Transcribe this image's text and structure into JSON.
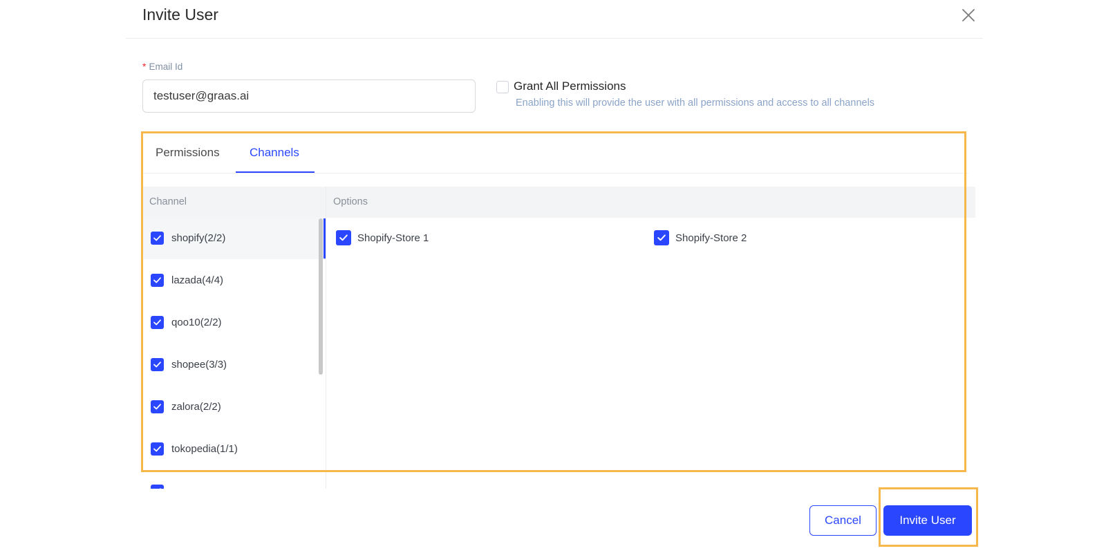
{
  "modal": {
    "title": "Invite User"
  },
  "email": {
    "label": "Email Id",
    "required_mark": "*",
    "value": "testuser@graas.ai"
  },
  "grant_all": {
    "label": "Grant All Permissions",
    "help": "Enabling this will provide the user with all permissions and access to all channels",
    "checked": false
  },
  "tabs": [
    {
      "label": "Permissions",
      "active": false
    },
    {
      "label": "Channels",
      "active": true
    }
  ],
  "table": {
    "headers": {
      "channel": "Channel",
      "options": "Options"
    },
    "channels": [
      {
        "label": "shopify(2/2)",
        "checked": true,
        "active": true
      },
      {
        "label": "lazada(4/4)",
        "checked": true
      },
      {
        "label": "qoo10(2/2)",
        "checked": true
      },
      {
        "label": "shopee(3/3)",
        "checked": true
      },
      {
        "label": "zalora(2/2)",
        "checked": true
      },
      {
        "label": "tokopedia(1/1)",
        "checked": true
      }
    ],
    "options": [
      {
        "label": "Shopify-Store 1",
        "checked": true
      },
      {
        "label": "Shopify-Store 2",
        "checked": true
      }
    ]
  },
  "footer": {
    "cancel_label": "Cancel",
    "invite_label": "Invite User"
  },
  "colors": {
    "accent": "#2a47ff",
    "highlight": "#f6b84a",
    "required": "#f5222d"
  }
}
